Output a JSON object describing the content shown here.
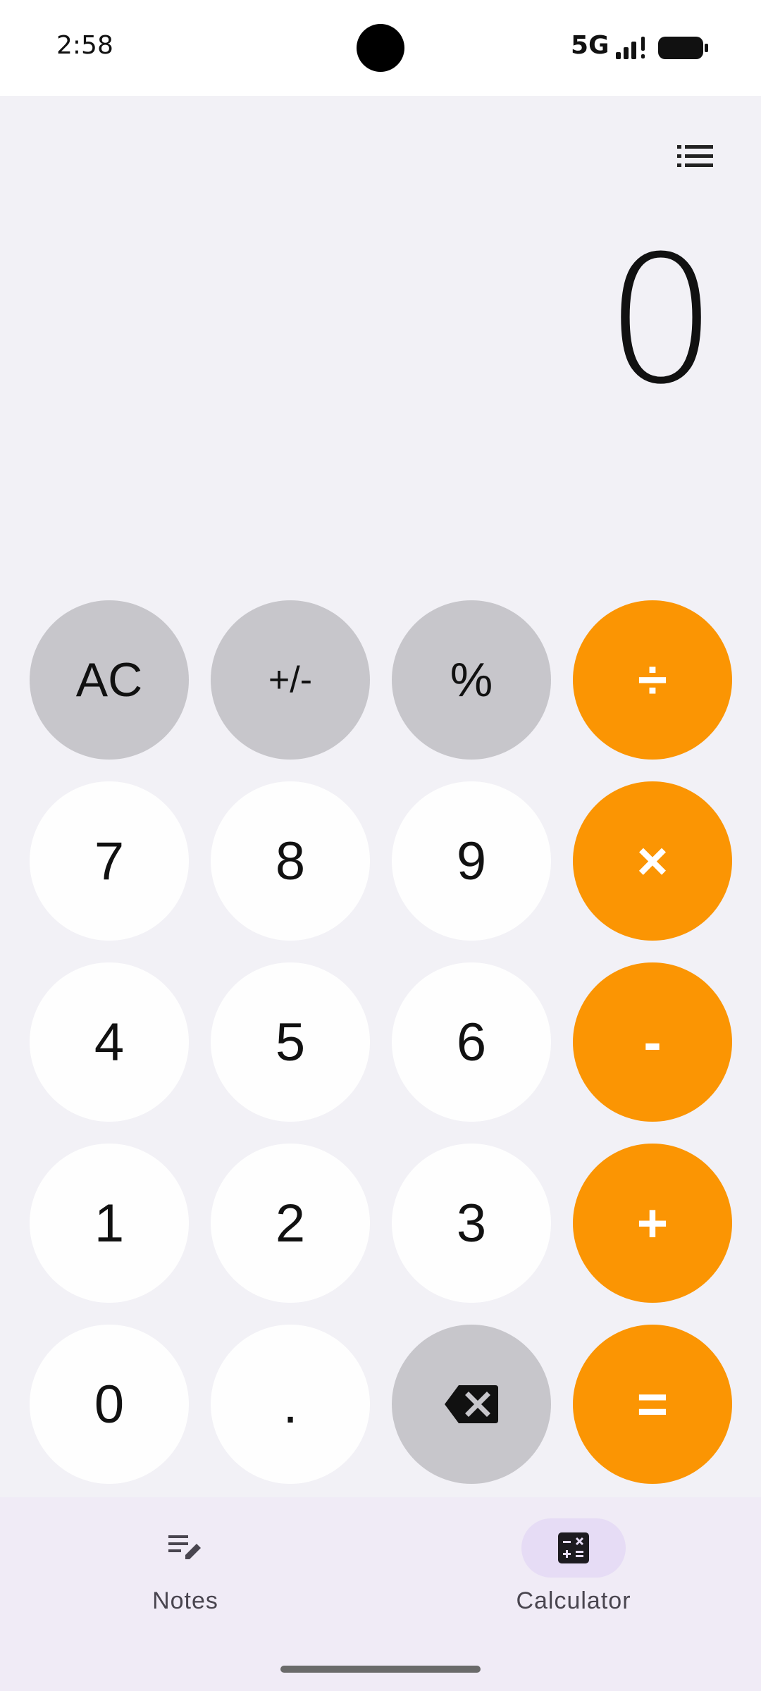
{
  "status_bar": {
    "time": "2:58",
    "network": "5G",
    "signal_icon": "signal-icon",
    "battery_icon": "battery-icon"
  },
  "header": {
    "history_icon": "list-icon"
  },
  "display": {
    "value": "0"
  },
  "keypad": {
    "rows": [
      [
        "AC",
        "+/-",
        "%",
        "÷"
      ],
      [
        "7",
        "8",
        "9",
        "×"
      ],
      [
        "4",
        "5",
        "6",
        "-"
      ],
      [
        "1",
        "2",
        "3",
        "+"
      ],
      [
        "0",
        ".",
        "",
        "="
      ]
    ],
    "backspace_icon": "backspace-icon"
  },
  "bottom_nav": {
    "items": [
      {
        "label": "Notes",
        "icon": "edit-notes-icon",
        "active": false
      },
      {
        "label": "Calculator",
        "icon": "calculator-icon",
        "active": true
      }
    ]
  },
  "colors": {
    "accent": "#fb9503",
    "key_light": "#fefefe",
    "key_gray": "#c7c6cb",
    "background": "#f2f1f6",
    "nav_background": "#f0ebf6",
    "nav_active": "#e6dcf5"
  }
}
